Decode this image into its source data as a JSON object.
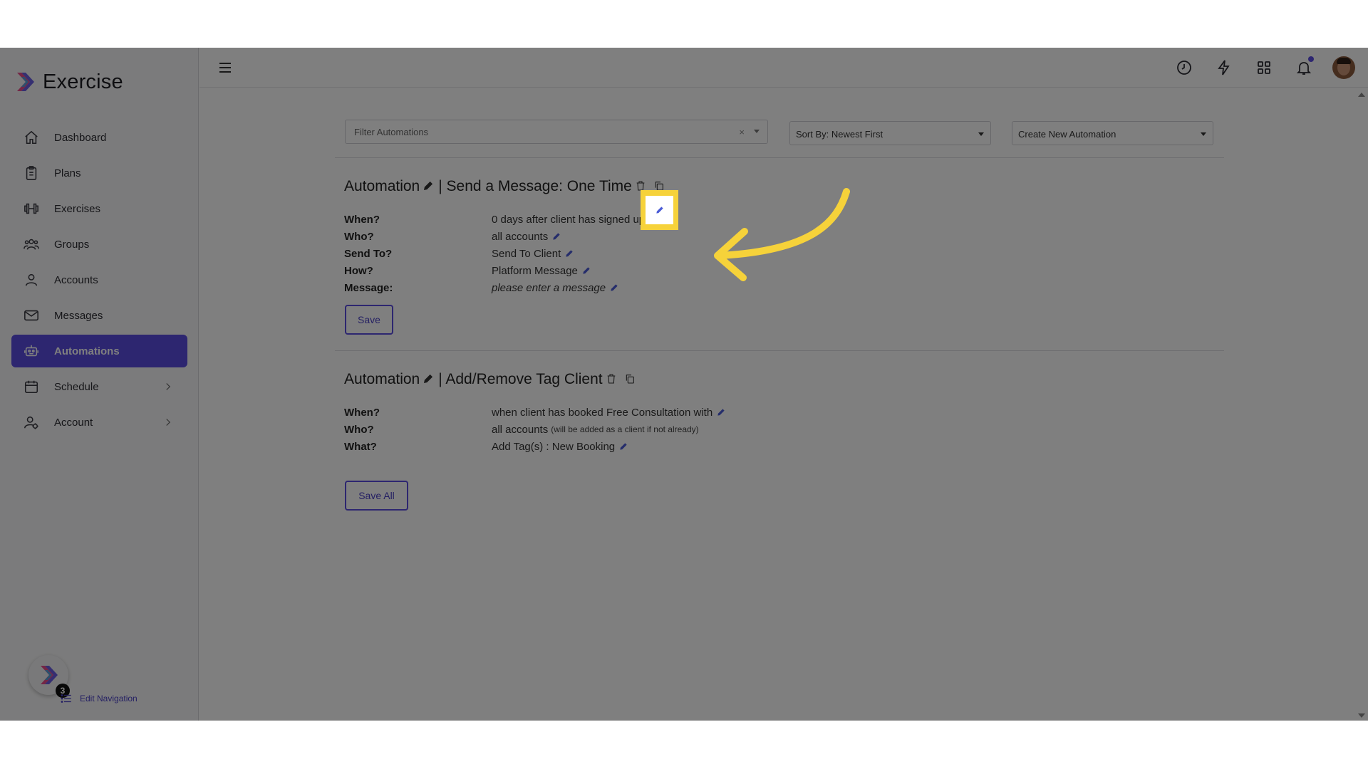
{
  "brand": {
    "name": "Exercise"
  },
  "sidebar": {
    "items": [
      {
        "label": "Dashboard",
        "icon": "home-icon"
      },
      {
        "label": "Plans",
        "icon": "clipboard-icon"
      },
      {
        "label": "Exercises",
        "icon": "dumbbell-icon"
      },
      {
        "label": "Groups",
        "icon": "users-icon"
      },
      {
        "label": "Accounts",
        "icon": "user-icon"
      },
      {
        "label": "Messages",
        "icon": "envelope-icon"
      },
      {
        "label": "Automations",
        "icon": "robot-icon",
        "active": true
      },
      {
        "label": "Schedule",
        "icon": "calendar-icon",
        "has_children": true
      },
      {
        "label": "Account",
        "icon": "user-gear-icon",
        "has_children": true
      }
    ],
    "badge_count": "3",
    "edit_navigation": "Edit Navigation"
  },
  "toolbar": {
    "filter_placeholder": "Filter Automations",
    "filter_clear": "×",
    "sort_label": "Sort By: Newest First",
    "create_label": "Create New Automation"
  },
  "automations": [
    {
      "prefix": "Automation",
      "title": "| Send a Message: One Time",
      "rows": [
        {
          "label": "When?",
          "value": "0 days after client has signed up"
        },
        {
          "label": "Who?",
          "value": "all accounts"
        },
        {
          "label": "Send To?",
          "value": "Send To Client"
        },
        {
          "label": "How?",
          "value": "Platform Message"
        },
        {
          "label": "Message:",
          "value": "please enter a message"
        }
      ],
      "button": "Save"
    },
    {
      "prefix": "Automation",
      "title": "| Add/Remove Tag Client",
      "rows": [
        {
          "label": "When?",
          "value": "when client has booked Free Consultation with"
        },
        {
          "label": "Who?",
          "value": "all accounts",
          "note": "(will be added as a client if not already)"
        },
        {
          "label": "What?",
          "value": "Add Tag(s) : New Booking"
        }
      ],
      "button": "Save All"
    }
  ],
  "colors": {
    "accent": "#5b4de0",
    "highlight": "#f6d23a",
    "pencil": "#4a5bd6"
  }
}
